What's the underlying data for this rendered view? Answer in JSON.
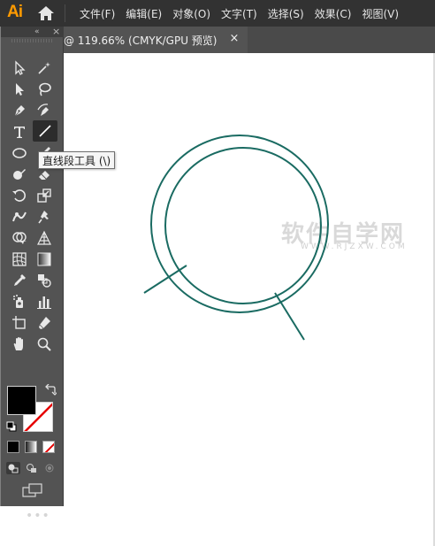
{
  "app": {
    "logo": "Ai",
    "home_icon": "home-icon"
  },
  "menu": {
    "items": [
      "文件(F)",
      "编辑(E)",
      "对象(O)",
      "文字(T)",
      "选择(S)",
      "效果(C)",
      "视图(V)"
    ]
  },
  "document_tab": {
    "label": "@ 119.66% (CMYK/GPU 预览)",
    "close": "×"
  },
  "toolbar": {
    "collapse": "«",
    "close": "×",
    "more": "•••",
    "tools": [
      {
        "name": "selection-tool-icon"
      },
      {
        "name": "magic-wand-icon"
      },
      {
        "name": "direct-selection-icon"
      },
      {
        "name": "lasso-icon"
      },
      {
        "name": "pen-tool-icon"
      },
      {
        "name": "curvature-tool-icon"
      },
      {
        "name": "type-tool-icon"
      },
      {
        "name": "line-segment-tool-icon"
      },
      {
        "name": "ellipse-tool-icon"
      },
      {
        "name": "paintbrush-tool-icon"
      },
      {
        "name": "shaper-tool-icon"
      },
      {
        "name": "eraser-tool-icon"
      },
      {
        "name": "rotate-tool-icon"
      },
      {
        "name": "scale-tool-icon"
      },
      {
        "name": "warp-tool-icon"
      },
      {
        "name": "puppet-warp-icon"
      },
      {
        "name": "shape-builder-icon"
      },
      {
        "name": "perspective-grid-icon"
      },
      {
        "name": "mesh-tool-icon"
      },
      {
        "name": "gradient-tool-icon"
      },
      {
        "name": "eyedropper-tool-icon"
      },
      {
        "name": "blend-tool-icon"
      },
      {
        "name": "symbol-sprayer-icon"
      },
      {
        "name": "column-graph-icon"
      },
      {
        "name": "artboard-tool-icon"
      },
      {
        "name": "slice-tool-icon"
      },
      {
        "name": "hand-tool-icon"
      },
      {
        "name": "zoom-tool-icon"
      }
    ],
    "fill_color": "#000000",
    "stroke_color": "none"
  },
  "tooltip": {
    "text": "直线段工具 (\\)"
  },
  "canvas": {
    "stroke_color": "#1a6b62",
    "watermark": "软件自学网",
    "watermark_sub": "WWW.RJZXW.COM"
  }
}
